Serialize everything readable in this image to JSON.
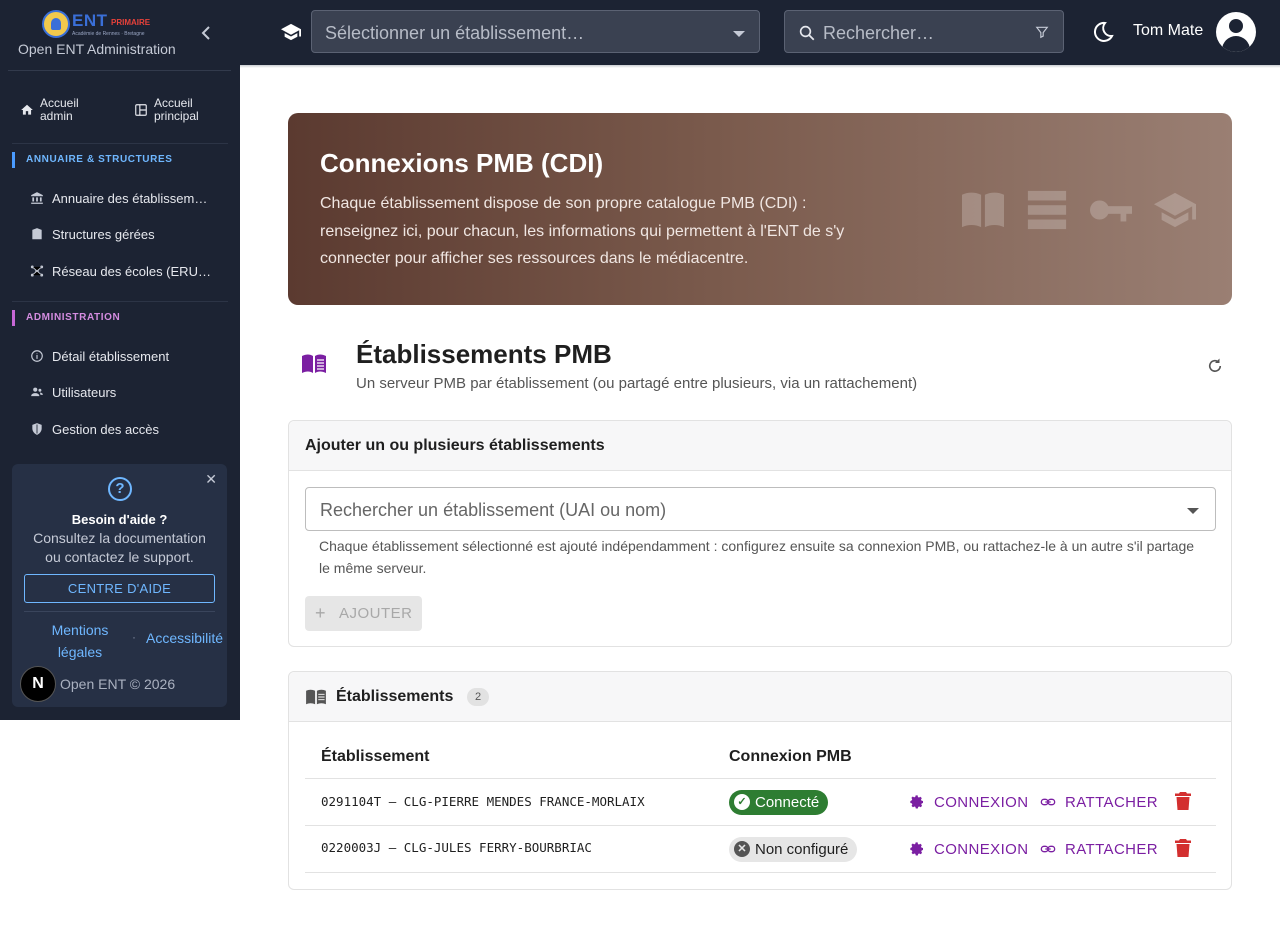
{
  "sidebar": {
    "logo_text": "ENT",
    "logo_sub": "PRIMAIRE",
    "logo_tag": "Académie de Rennes · Bretagne",
    "app_title": "Open ENT Administration",
    "quick_links": [
      {
        "label": "Accueil admin",
        "icon": "home-icon"
      },
      {
        "label": "Accueil principal",
        "icon": "grid-icon"
      }
    ],
    "sections": [
      {
        "title": "ANNUAIRE & STRUCTURES",
        "color": "#4a9bff",
        "items": [
          {
            "label": "Annuaire des établissem…",
            "icon": "bank-icon"
          },
          {
            "label": "Structures gérées",
            "icon": "building-icon"
          },
          {
            "label": "Réseau des écoles (ERU…",
            "icon": "network-icon"
          }
        ]
      },
      {
        "title": "ADMINISTRATION",
        "color": "#c667d6",
        "items": [
          {
            "label": "Détail établissement",
            "icon": "info-icon"
          },
          {
            "label": "Utilisateurs",
            "icon": "users-icon"
          },
          {
            "label": "Gestion des accès",
            "icon": "shield-icon"
          }
        ]
      }
    ],
    "help": {
      "title": "Besoin d'aide ?",
      "text": "Consultez la documentation ou contactez le support.",
      "button": "CENTRE D'AIDE",
      "link_legal": "Mentions légales",
      "separator": "·",
      "link_access": "Accessibilité",
      "avatar_letter": "N",
      "copyright": "Open ENT © 2026"
    }
  },
  "topbar": {
    "select_placeholder": "Sélectionner un établissement…",
    "search_placeholder": "Rechercher…",
    "user_name": "Tom Mate"
  },
  "hero": {
    "title": "Connexions PMB (CDI)",
    "description": "Chaque établissement dispose de son propre catalogue PMB (CDI) : renseignez ici, pour chacun, les informations qui permettent à l'ENT de s'y connecter pour afficher ses ressources dans le médiacentre."
  },
  "section": {
    "title": "Établissements PMB",
    "subtitle": "Un serveur PMB par établissement (ou partagé entre plusieurs, via un rattachement)"
  },
  "add_card": {
    "title": "Ajouter un ou plusieurs établissements",
    "search_placeholder": "Rechercher un établissement (UAI ou nom)",
    "hint": "Chaque établissement sélectionné est ajouté indépendamment : configurez ensuite sa connexion PMB, ou rattachez-le à un autre s'il partage le même serveur.",
    "add_button": "AJOUTER"
  },
  "list_card": {
    "title": "Établissements",
    "count": "2",
    "columns": [
      "Établissement",
      "Connexion PMB"
    ],
    "rows": [
      {
        "etab": "0291104T — CLG-PIERRE MENDES FRANCE-MORLAIX",
        "status": "Connecté",
        "status_kind": "ok"
      },
      {
        "etab": "0220003J — CLG-JULES FERRY-BOURBRIAC",
        "status": "Non configuré",
        "status_kind": "none"
      }
    ],
    "action_connexion": "CONNEXION",
    "action_rattacher": "RATTACHER"
  },
  "colors": {
    "sidebar_bg": "#1c2333",
    "accent_purple": "#7b1fa2",
    "delete_red": "#d32f2f",
    "status_ok": "#2e7d32"
  }
}
